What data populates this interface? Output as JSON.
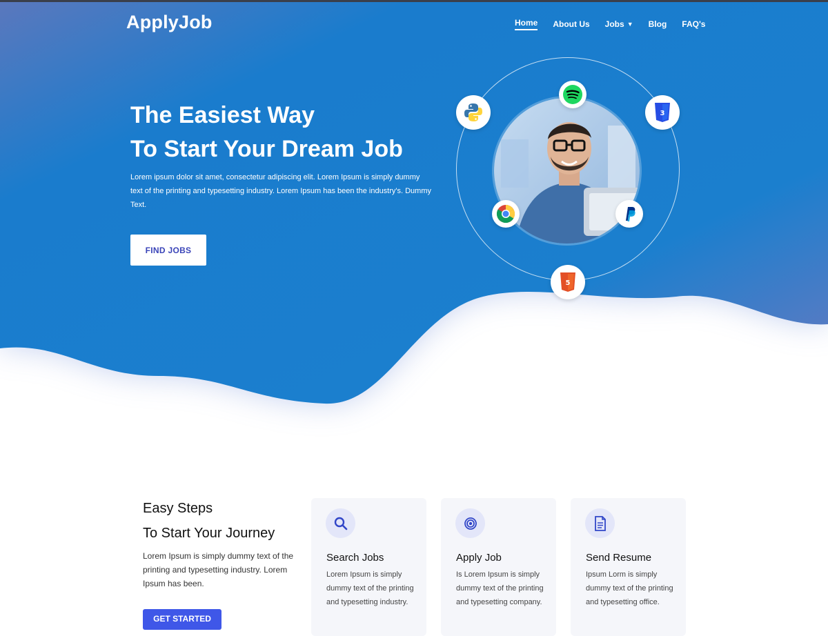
{
  "brand": {
    "logo": "ApplyJob"
  },
  "nav": {
    "items": [
      {
        "label": "Home",
        "active": true
      },
      {
        "label": "About Us"
      },
      {
        "label": "Jobs",
        "has_dropdown": true
      },
      {
        "label": "Blog"
      },
      {
        "label": "FAQ's"
      }
    ]
  },
  "hero": {
    "title_line1": "The Easiest Way",
    "title_line2": "To Start Your Dream Job",
    "description": "Lorem ipsum dolor sit amet, consectetur adipiscing elit. Lorem Ipsum is simply dummy text of the printing and typesetting industry. Lorem Ipsum has been the industry's. Dummy Text.",
    "cta_label": "FIND JOBS",
    "badges": [
      "python-icon",
      "spotify-icon",
      "css3-icon",
      "chrome-icon",
      "paypal-icon",
      "html5-icon"
    ]
  },
  "steps": {
    "title_line1": "Easy Steps",
    "title_line2": "To Start Your Journey",
    "description": "Lorem Ipsum is simply dummy text of the printing and typesetting industry. Lorem Ipsum has been.",
    "cta_label": "GET STARTED",
    "cards": [
      {
        "icon": "search-icon",
        "title": "Search Jobs",
        "text": "Lorem Ipsum is simply dummy text of the printing and typesetting industry."
      },
      {
        "icon": "target-icon",
        "title": "Apply Job",
        "text": "Is Lorem Ipsum is simply dummy text of the printing and typesetting company."
      },
      {
        "icon": "document-icon",
        "title": "Send Resume",
        "text": "Ipsum Lorm is simply dummy text of the printing and typesetting office."
      }
    ]
  },
  "colors": {
    "hero_primary": "#1a7ccd",
    "hero_accent": "#7b7fbe",
    "button_blue": "#3f57e8",
    "card_bg": "#f5f6fa"
  }
}
